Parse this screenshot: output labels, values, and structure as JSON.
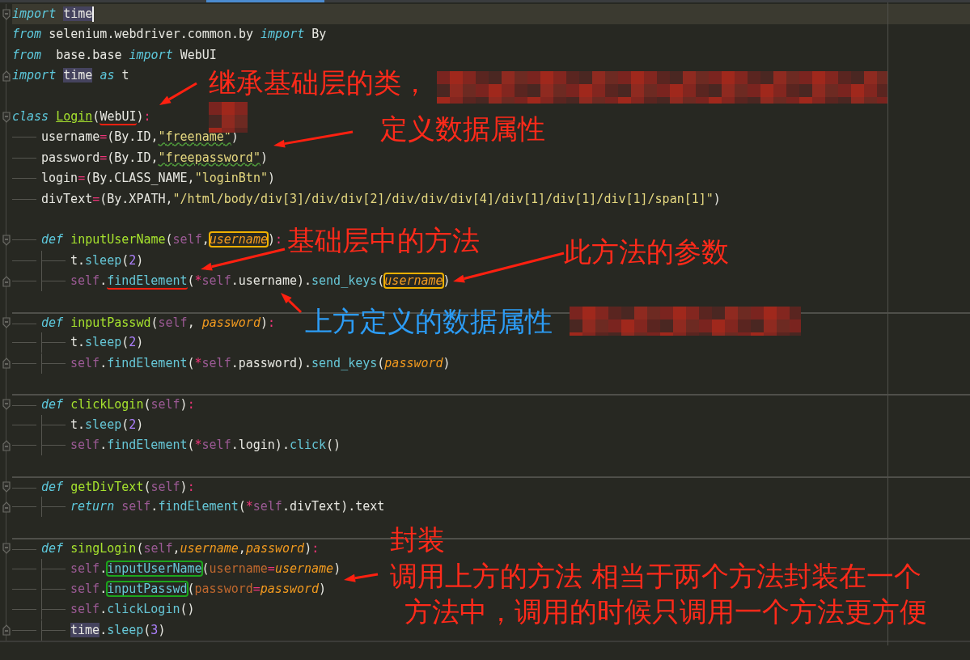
{
  "editor": {
    "lines": [
      {
        "current": true,
        "separator_above": false,
        "fold": {
          "kind": "start"
        },
        "tokens": [
          {
            "kind": "kw",
            "text": "import"
          },
          {
            "kind": "hl",
            "text": " time"
          }
        ]
      },
      {
        "current": false,
        "separator_above": false,
        "tokens": [
          {
            "kind": "kw",
            "text": "from"
          },
          {
            "kind": "plain",
            "text": " selenium.webdriver.common.by"
          },
          {
            "kind": "kw",
            "text": " import"
          },
          {
            "kind": "plain",
            "text": " By"
          }
        ]
      },
      {
        "current": false,
        "separator_above": false,
        "tokens": [
          {
            "kind": "kw",
            "text": "from"
          },
          {
            "kind": "plain",
            "text": "  base.base"
          },
          {
            "kind": "kw",
            "text": " import"
          },
          {
            "kind": "plain",
            "text": " WebUI"
          }
        ]
      },
      {
        "current": false,
        "separator_above": false,
        "fold": {
          "kind": "end"
        },
        "tokens": [
          {
            "kind": "kw",
            "text": "import"
          },
          {
            "kind": "hl",
            "text": " time"
          },
          {
            "kind": "kw",
            "text": " as"
          },
          {
            "kind": "plain",
            "text": " t"
          }
        ]
      },
      {
        "current": false,
        "separator_above": false
      },
      {
        "current": false,
        "separator_above": false,
        "fold": {
          "kind": "start"
        },
        "tokens": [
          {
            "kind": "kw",
            "text": "class"
          },
          {
            "kind": "cls",
            "text": " Login"
          },
          {
            "kind": "plain",
            "text": "("
          },
          {
            "kind": "plain",
            "text": "WebUI",
            "mark": {
              "kind": "underline"
            }
          },
          {
            "kind": "plain",
            "text": ")"
          },
          {
            "kind": "op",
            "text": ":"
          }
        ]
      },
      {
        "current": false,
        "separator_above": false,
        "tokens": [
          {
            "kind": "plain",
            "text": "    username"
          },
          {
            "kind": "op",
            "text": "="
          },
          {
            "kind": "plain",
            "text": "(By.ID,"
          },
          {
            "kind": "str",
            "text": "\"freename\"",
            "mark": {
              "kind": "squiggle"
            }
          },
          {
            "kind": "plain",
            "text": ")"
          }
        ]
      },
      {
        "current": false,
        "separator_above": false,
        "tokens": [
          {
            "kind": "plain",
            "text": "    password"
          },
          {
            "kind": "op",
            "text": "="
          },
          {
            "kind": "plain",
            "text": "(By.ID,"
          },
          {
            "kind": "str",
            "text": "\"freepassword\"",
            "mark": {
              "kind": "squiggle"
            }
          },
          {
            "kind": "plain",
            "text": ")"
          }
        ]
      },
      {
        "current": false,
        "separator_above": false,
        "tokens": [
          {
            "kind": "plain",
            "text": "    login"
          },
          {
            "kind": "op",
            "text": "="
          },
          {
            "kind": "plain",
            "text": "(By.CLASS_NAME,"
          },
          {
            "kind": "str",
            "text": "\"loginBtn\""
          },
          {
            "kind": "plain",
            "text": ")"
          }
        ]
      },
      {
        "current": false,
        "separator_above": false,
        "tokens": [
          {
            "kind": "plain",
            "text": "    divText"
          },
          {
            "kind": "op",
            "text": "="
          },
          {
            "kind": "plain",
            "text": "(By.XPATH,"
          },
          {
            "kind": "str",
            "text": "\"/html/body/div[3]/div/div[2]/div/div/div[4]/div[1]/div[1]/div[1]/span[1]\""
          },
          {
            "kind": "plain",
            "text": ")"
          }
        ]
      },
      {
        "current": false,
        "separator_above": false
      },
      {
        "current": false,
        "separator_above": false,
        "fold": {
          "kind": "start"
        },
        "tokens": [
          {
            "kind": "kw",
            "text": "    def"
          },
          {
            "kind": "fn",
            "text": " inputUserName"
          },
          {
            "kind": "plain",
            "text": "("
          },
          {
            "kind": "self",
            "text": "self"
          },
          {
            "kind": "plain",
            "text": ","
          },
          {
            "kind": "param",
            "text": "username",
            "mark": {
              "kind": "box-orange"
            }
          },
          {
            "kind": "plain",
            "text": ")"
          },
          {
            "kind": "op",
            "text": ":"
          }
        ]
      },
      {
        "current": false,
        "separator_above": false,
        "tokens": [
          {
            "kind": "plain",
            "text": "        t."
          },
          {
            "kind": "call",
            "text": "sleep"
          },
          {
            "kind": "plain",
            "text": "("
          },
          {
            "kind": "num",
            "text": "2"
          },
          {
            "kind": "plain",
            "text": ")"
          }
        ]
      },
      {
        "current": false,
        "separator_above": false,
        "fold": {
          "kind": "end"
        },
        "tokens": [
          {
            "kind": "self",
            "text": "        self"
          },
          {
            "kind": "plain",
            "text": "."
          },
          {
            "kind": "call",
            "text": "findElement",
            "mark": {
              "kind": "underline"
            }
          },
          {
            "kind": "plain",
            "text": "("
          },
          {
            "kind": "op",
            "text": "*"
          },
          {
            "kind": "self",
            "text": "self"
          },
          {
            "kind": "plain",
            "text": ".username)."
          },
          {
            "kind": "call",
            "text": "send_keys"
          },
          {
            "kind": "plain",
            "text": "("
          },
          {
            "kind": "param",
            "text": "username",
            "mark": {
              "kind": "box-orange"
            }
          },
          {
            "kind": "plain",
            "text": ")"
          }
        ]
      },
      {
        "current": false,
        "separator_above": false
      },
      {
        "current": false,
        "separator_above": true,
        "fold": {
          "kind": "start"
        },
        "tokens": [
          {
            "kind": "kw",
            "text": "    def"
          },
          {
            "kind": "fn",
            "text": " inputPasswd"
          },
          {
            "kind": "plain",
            "text": "("
          },
          {
            "kind": "self",
            "text": "self"
          },
          {
            "kind": "plain",
            "text": ","
          },
          {
            "kind": "param",
            "text": " password"
          },
          {
            "kind": "plain",
            "text": ")"
          },
          {
            "kind": "op",
            "text": ":"
          }
        ]
      },
      {
        "current": false,
        "separator_above": false,
        "tokens": [
          {
            "kind": "plain",
            "text": "        t."
          },
          {
            "kind": "call",
            "text": "sleep"
          },
          {
            "kind": "plain",
            "text": "("
          },
          {
            "kind": "num",
            "text": "2"
          },
          {
            "kind": "plain",
            "text": ")"
          }
        ]
      },
      {
        "current": false,
        "separator_above": false,
        "fold": {
          "kind": "end"
        },
        "tokens": [
          {
            "kind": "self",
            "text": "        self"
          },
          {
            "kind": "plain",
            "text": "."
          },
          {
            "kind": "call",
            "text": "findElement"
          },
          {
            "kind": "plain",
            "text": "("
          },
          {
            "kind": "op",
            "text": "*"
          },
          {
            "kind": "self",
            "text": "self"
          },
          {
            "kind": "plain",
            "text": ".password)."
          },
          {
            "kind": "call",
            "text": "send_keys"
          },
          {
            "kind": "plain",
            "text": "("
          },
          {
            "kind": "param",
            "text": "password"
          },
          {
            "kind": "plain",
            "text": ")"
          }
        ]
      },
      {
        "current": false,
        "separator_above": false
      },
      {
        "current": false,
        "separator_above": true,
        "fold": {
          "kind": "start"
        },
        "tokens": [
          {
            "kind": "kw",
            "text": "    def"
          },
          {
            "kind": "fn",
            "text": " clickLogin"
          },
          {
            "kind": "plain",
            "text": "("
          },
          {
            "kind": "self",
            "text": "self"
          },
          {
            "kind": "plain",
            "text": ")"
          },
          {
            "kind": "op",
            "text": ":"
          }
        ]
      },
      {
        "current": false,
        "separator_above": false,
        "tokens": [
          {
            "kind": "plain",
            "text": "        t."
          },
          {
            "kind": "call",
            "text": "sleep"
          },
          {
            "kind": "plain",
            "text": "("
          },
          {
            "kind": "num",
            "text": "2"
          },
          {
            "kind": "plain",
            "text": ")"
          }
        ]
      },
      {
        "current": false,
        "separator_above": false,
        "fold": {
          "kind": "end"
        },
        "tokens": [
          {
            "kind": "self",
            "text": "        self"
          },
          {
            "kind": "plain",
            "text": "."
          },
          {
            "kind": "call",
            "text": "findElement"
          },
          {
            "kind": "plain",
            "text": "("
          },
          {
            "kind": "op",
            "text": "*"
          },
          {
            "kind": "self",
            "text": "self"
          },
          {
            "kind": "plain",
            "text": ".login)."
          },
          {
            "kind": "call",
            "text": "click"
          },
          {
            "kind": "plain",
            "text": "()"
          }
        ]
      },
      {
        "current": false,
        "separator_above": false
      },
      {
        "current": false,
        "separator_above": true,
        "fold": {
          "kind": "start"
        },
        "tokens": [
          {
            "kind": "kw",
            "text": "    def"
          },
          {
            "kind": "fn",
            "text": " getDivText"
          },
          {
            "kind": "plain",
            "text": "("
          },
          {
            "kind": "self",
            "text": "self"
          },
          {
            "kind": "plain",
            "text": ")"
          },
          {
            "kind": "op",
            "text": ":"
          }
        ]
      },
      {
        "current": false,
        "separator_above": false,
        "fold": {
          "kind": "end"
        },
        "tokens": [
          {
            "kind": "kw",
            "text": "        return"
          },
          {
            "kind": "self",
            "text": " self"
          },
          {
            "kind": "plain",
            "text": "."
          },
          {
            "kind": "call",
            "text": "findElement"
          },
          {
            "kind": "plain",
            "text": "("
          },
          {
            "kind": "op",
            "text": "*"
          },
          {
            "kind": "self",
            "text": "self"
          },
          {
            "kind": "plain",
            "text": ".divText).text"
          }
        ]
      },
      {
        "current": false,
        "separator_above": false
      },
      {
        "current": false,
        "separator_above": true,
        "fold": {
          "kind": "start"
        },
        "tokens": [
          {
            "kind": "kw",
            "text": "    def"
          },
          {
            "kind": "fn",
            "text": " singLogin"
          },
          {
            "kind": "plain",
            "text": "("
          },
          {
            "kind": "self",
            "text": "self"
          },
          {
            "kind": "plain",
            "text": ","
          },
          {
            "kind": "param",
            "text": "username"
          },
          {
            "kind": "plain",
            "text": ","
          },
          {
            "kind": "param",
            "text": "password"
          },
          {
            "kind": "plain",
            "text": ")"
          },
          {
            "kind": "op",
            "text": ":"
          }
        ]
      },
      {
        "current": false,
        "separator_above": false,
        "tokens": [
          {
            "kind": "self",
            "text": "        self"
          },
          {
            "kind": "plain",
            "text": "."
          },
          {
            "kind": "call",
            "text": "inputUserName",
            "mark": {
              "kind": "box-green"
            }
          },
          {
            "kind": "plain",
            "text": "("
          },
          {
            "kind": "arg",
            "text": "username"
          },
          {
            "kind": "op",
            "text": "="
          },
          {
            "kind": "param",
            "text": "username"
          },
          {
            "kind": "plain",
            "text": ")"
          }
        ]
      },
      {
        "current": false,
        "separator_above": false,
        "tokens": [
          {
            "kind": "self",
            "text": "        self"
          },
          {
            "kind": "plain",
            "text": "."
          },
          {
            "kind": "call",
            "text": "inputPasswd",
            "mark": {
              "kind": "box-green"
            }
          },
          {
            "kind": "plain",
            "text": "("
          },
          {
            "kind": "arg",
            "text": "password"
          },
          {
            "kind": "op",
            "text": "="
          },
          {
            "kind": "param",
            "text": "password"
          },
          {
            "kind": "plain",
            "text": ")"
          }
        ]
      },
      {
        "current": false,
        "separator_above": false,
        "tokens": [
          {
            "kind": "self",
            "text": "        self"
          },
          {
            "kind": "plain",
            "text": "."
          },
          {
            "kind": "call",
            "text": "clickLogin"
          },
          {
            "kind": "plain",
            "text": "()"
          }
        ]
      },
      {
        "current": false,
        "separator_above": false,
        "fold": {
          "kind": "end"
        },
        "tokens": [
          {
            "kind": "hl",
            "text": "        time"
          },
          {
            "kind": "plain",
            "text": "."
          },
          {
            "kind": "call",
            "text": "sleep"
          },
          {
            "kind": "plain",
            "text": "("
          },
          {
            "kind": "num",
            "text": "3"
          },
          {
            "kind": "plain",
            "text": ")"
          }
        ]
      }
    ]
  },
  "annotations": [
    {
      "text": "继承基础层的类，",
      "color": "#ff2a1a"
    },
    {
      "text": "定义数据属性",
      "color": "#ff2a1a"
    },
    {
      "text": "基础层中的方法",
      "color": "#ff2a1a"
    },
    {
      "text": "此方法的参数",
      "color": "#ff2a1a"
    },
    {
      "text": "上方定义的数据属性",
      "color": "#2c9cf5"
    },
    {
      "text": "封装",
      "color": "#ff2a1a"
    },
    {
      "text": "调用上方的方法 相当于两个方法封装在一个",
      "color": "#ff2a1a"
    },
    {
      "text": "方法中，调用的时候只调用一个方法更方便",
      "color": "#ff2a1a"
    }
  ]
}
